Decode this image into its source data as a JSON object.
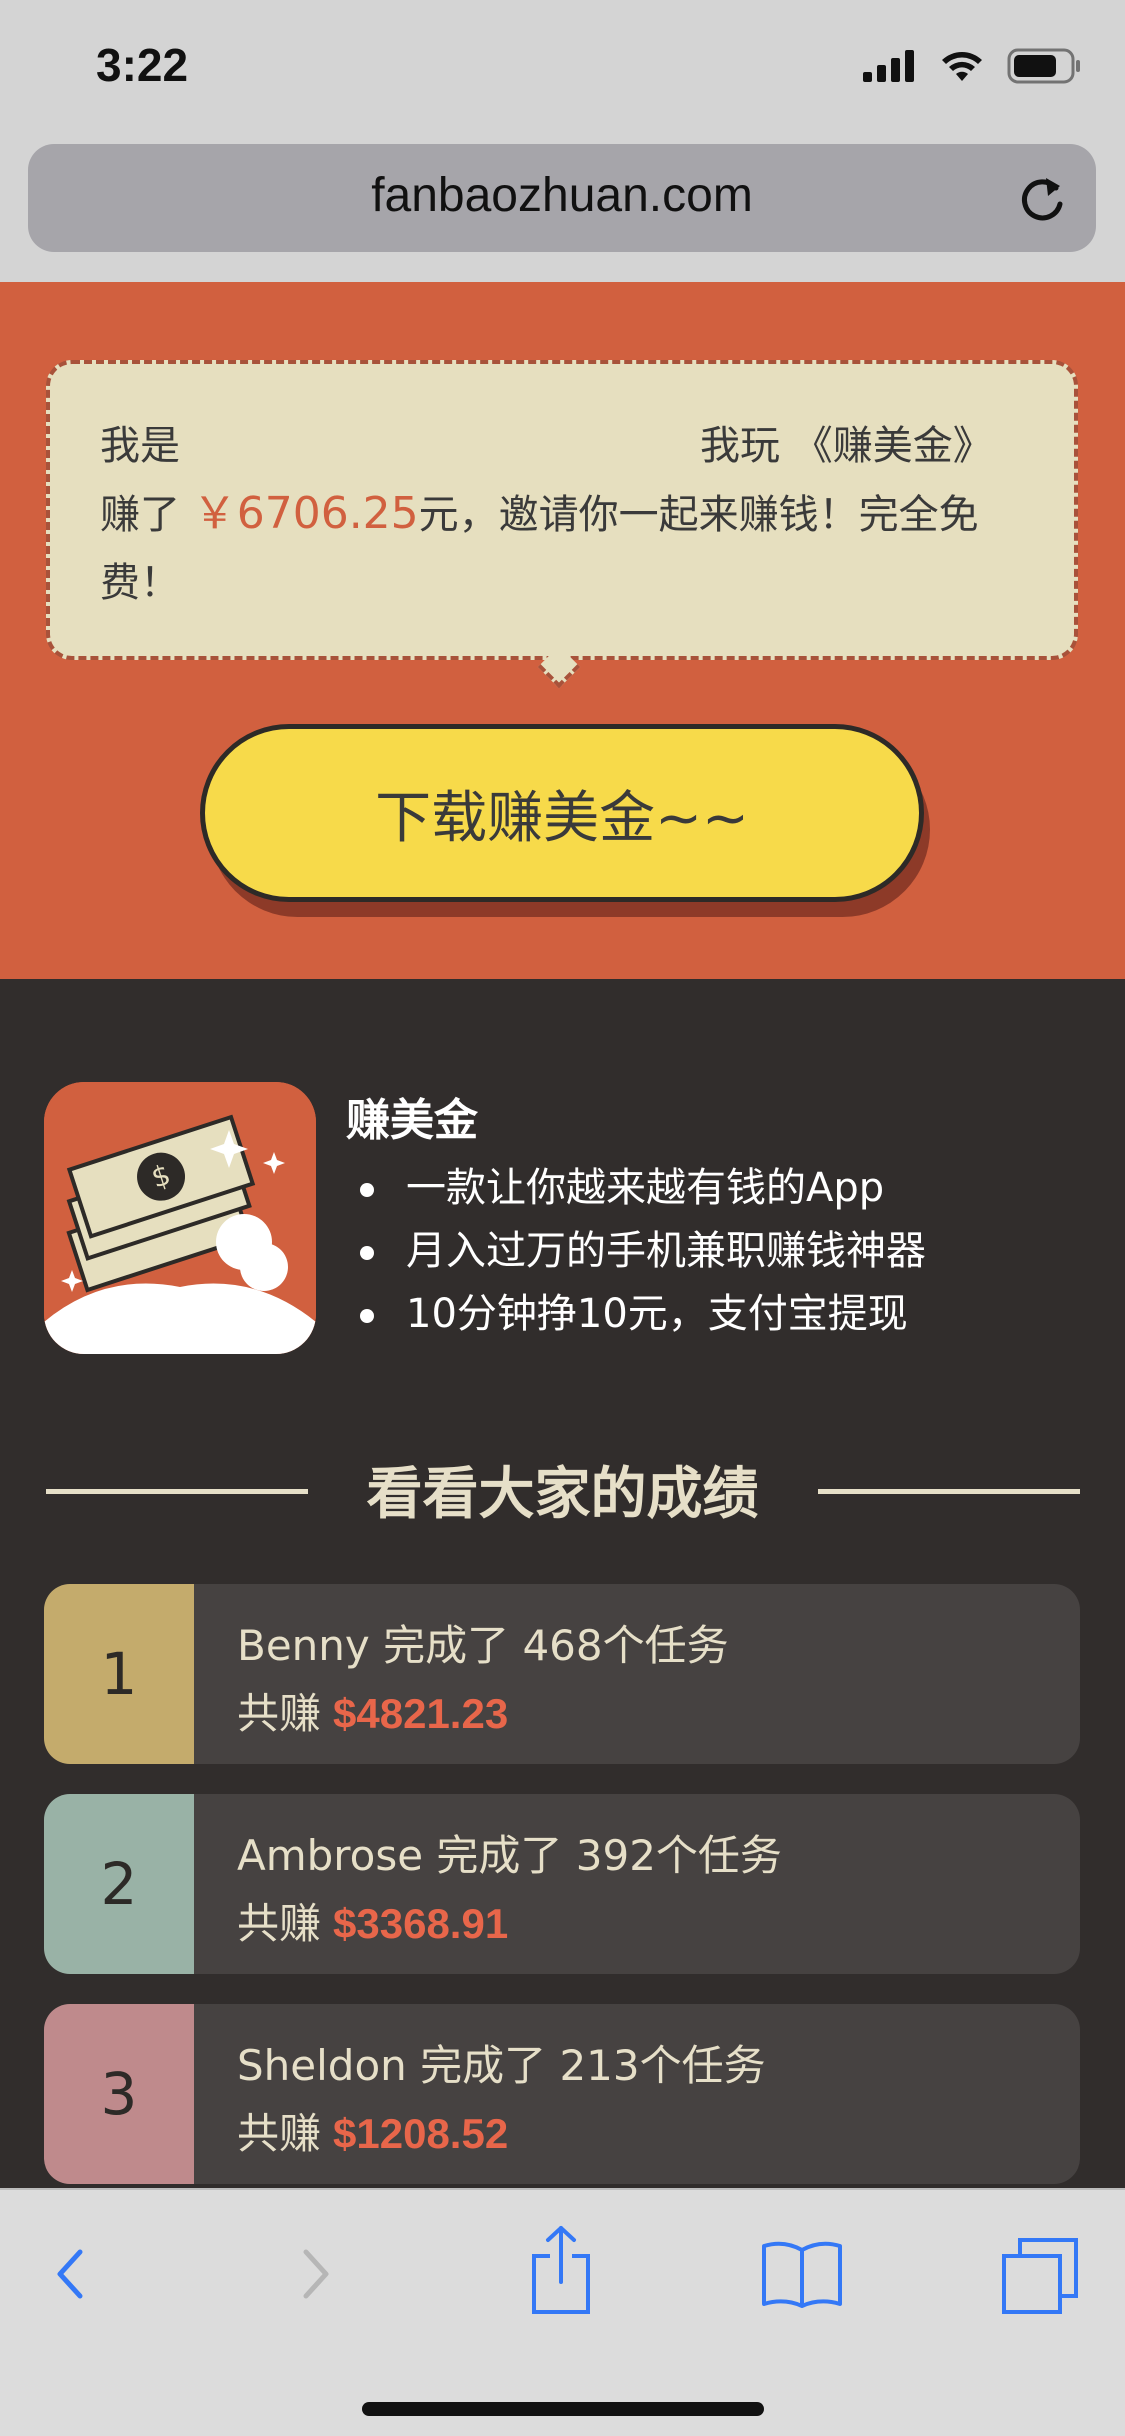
{
  "status_bar": {
    "time": "3:22"
  },
  "browser": {
    "url": "fanbaozhuan.com"
  },
  "hero": {
    "invite_prefix": "我是",
    "invite_mid": "我玩 《赚美金》 赚了",
    "invite_amount": "￥6706.25",
    "invite_suffix": "元，邀请你一起来赚钱！完全免费！",
    "download_label": "下载赚美金~~"
  },
  "app_info": {
    "name": "赚美金",
    "features": [
      "一款让你越来越有钱的App",
      "月入过万的手机兼职赚钱神器",
      "10分钟挣10元，支付宝提现"
    ]
  },
  "leaderboard": {
    "title": "看看大家的成绩",
    "entries": [
      {
        "rank": "1",
        "line1": "Benny 完成了 468个任务",
        "earn_label": "共赚",
        "earn_amount": "$4821.23",
        "color": "#c4ab6c"
      },
      {
        "rank": "2",
        "line1": "Ambrose 完成了 392个任务",
        "earn_label": "共赚",
        "earn_amount": "$3368.91",
        "color": "#99b2a6"
      },
      {
        "rank": "3",
        "line1": "Sheldon 完成了 213个任务",
        "earn_label": "共赚",
        "earn_amount": "$1208.52",
        "color": "#bf8a8c"
      }
    ]
  },
  "colors": {
    "accent": "#d1603f",
    "button": "#f7da4a",
    "dark_bg": "#312d2c",
    "ios_blue": "#3478f6"
  },
  "icons": [
    "signal-icon",
    "wifi-icon",
    "battery-icon",
    "reload-icon",
    "back-icon",
    "forward-icon",
    "share-icon",
    "bookmarks-icon",
    "tabs-icon"
  ]
}
